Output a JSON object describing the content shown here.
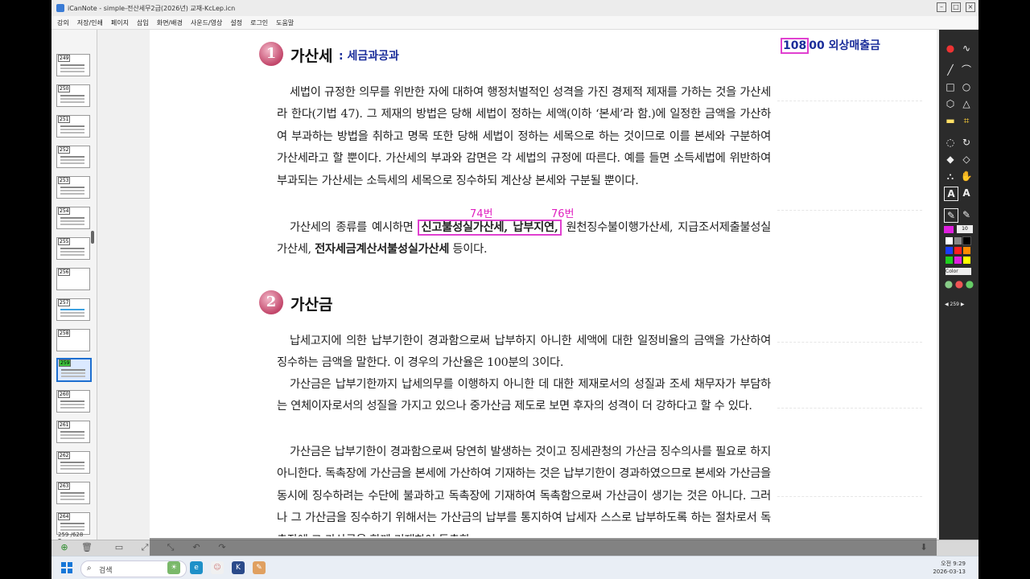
{
  "window": {
    "title": "iCanNote - simple-전산세무2급(2026년) 교재-KcLep.icn"
  },
  "menu": [
    "강의",
    "저장/인쇄",
    "페이지",
    "삽입",
    "화면/배경",
    "사운드/영상",
    "설정",
    "로그인",
    "도움말"
  ],
  "thumbnails": [
    "249",
    "250",
    "251",
    "252",
    "253",
    "254",
    "255",
    "256",
    "257",
    "258",
    "259",
    "260",
    "261",
    "262",
    "263",
    "264"
  ],
  "page_info": "259 /628 Page",
  "top_note": {
    "boxed": "108",
    "rest": "00  외상매출금"
  },
  "section1": {
    "num": "1",
    "title": "가산세",
    "subtitle": ": 세금과공과"
  },
  "section2": {
    "num": "2",
    "title": "가산금"
  },
  "s1_para1": "세법이 규정한 의무를 위반한 자에 대하여 행정처벌적인 성격을 가진 경제적 제재를 가하는 것을 가산세라 한다(기법 47). 그 제재의 방법은 당해 세법이 정하는 세액(이하 ‘본세’라 함.)에 일정한 금액을 가산하여 부과하는 방법을 취하고 명목 또한 당해 세법이 정하는 세목으로 하는 것이므로 이를 본세와 구분하여 가산세라고 할 뿐이다. 가산세의 부과와 감면은 각 세법의 규정에 따른다. 예를 들면 소득세법에 위반하여 부과되는 가산세는 소득세의 세목으로 징수하되 계산상 본세와 구분될 뿐이다.",
  "s1_para2": {
    "lead": "가산세의 종류를 예시하면 ",
    "highlight": "신고불성실가산세, 납부지연,",
    "middle": " 원천징수불이행가산세, 지급조서제출불성실가산세, ",
    "bold": "전자세금계산서불성실가산세",
    "tail": " 등이다."
  },
  "annotations": {
    "a1": "74번",
    "a2": "76번"
  },
  "s2_para1": "납세고지에 의한 납부기한이 경과함으로써 납부하지 아니한 세액에 대한 일정비율의 금액을 가산하여 징수하는 금액을 말한다. 이 경우의 가산율은 100분의 3이다.",
  "s2_para2": "가산금은 납부기한까지 납세의무를 이행하지 아니한 데 대한 제재로서의 성질과 조세 채무자가 부담하는 연체이자로서의 성질을 가지고 있으나 중가산금 제도로 보면 후자의 성격이 더 강하다고 할 수 있다.",
  "s2_para3": "가산금은 납부기한이 경과함으로써 당연히 발생하는 것이고 징세관청의 가산금 징수의사를 필요로 하지 아니한다. 독촉장에 가산금을 본세에 가산하여 기재하는 것은 납부기한이 경과하였으므로 본세와 가산금을 동시에 징수하려는 수단에 불과하고 독촉장에 기재하여 독촉함으로써 가산금이 생기는 것은 아니다. 그러나 그 가산금을 징수하기 위해서는 가산금의 납부를 통지하여 납세자 스스로 납부하도록 하는 절차로서 독촉장에 그 가산금을 함께 기재하여 독촉한",
  "toolbar": {
    "pen_size": "10",
    "color_label": "Color",
    "page_num": "259",
    "colors": [
      "#ffffff",
      "#888888",
      "#000000",
      "#1a3cff",
      "#ff2020",
      "#ff8c00",
      "#20d020",
      "#e020e0",
      "#ffff00"
    ]
  },
  "taskbar": {
    "search": "검색",
    "time": "오전 9:29",
    "date": "2026-03-13"
  }
}
